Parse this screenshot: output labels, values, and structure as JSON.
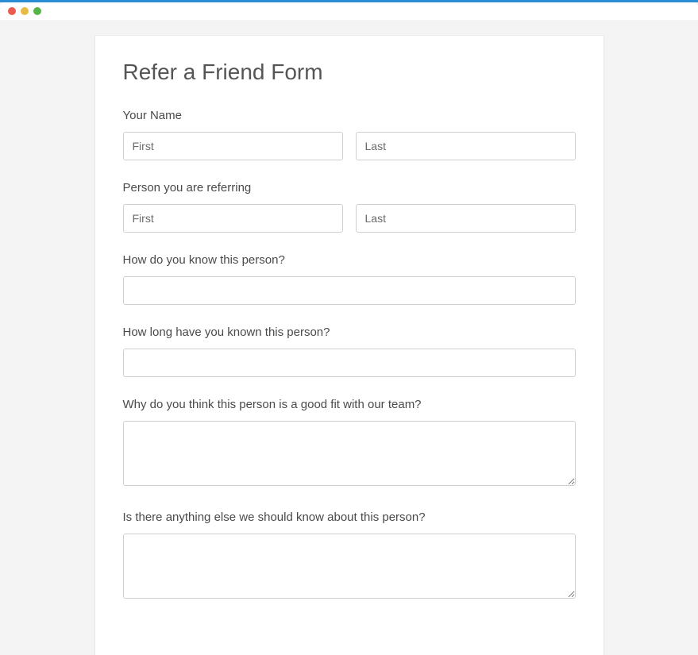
{
  "form": {
    "title": "Refer a Friend Form",
    "yourName": {
      "label": "Your Name",
      "first": {
        "placeholder": "First",
        "value": ""
      },
      "last": {
        "placeholder": "Last",
        "value": ""
      }
    },
    "referring": {
      "label": "Person you are referring",
      "first": {
        "placeholder": "First",
        "value": ""
      },
      "last": {
        "placeholder": "Last",
        "value": ""
      }
    },
    "howKnow": {
      "label": "How do you know this person?",
      "value": ""
    },
    "howLong": {
      "label": "How long have you known this person?",
      "value": ""
    },
    "whyFit": {
      "label": "Why do you think this person is a good fit with our team?",
      "value": ""
    },
    "anythingElse": {
      "label": "Is there anything else we should know about this person?",
      "value": ""
    }
  }
}
